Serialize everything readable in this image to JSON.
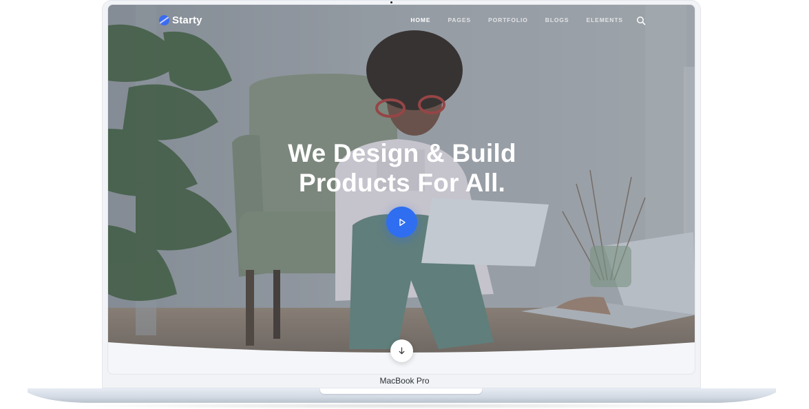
{
  "brand": {
    "name": "Starty",
    "accent": "#2f6ef0"
  },
  "nav": {
    "items": [
      {
        "label": "HOME",
        "active": true
      },
      {
        "label": "PAGES",
        "active": false
      },
      {
        "label": "PORTFOLIO",
        "active": false
      },
      {
        "label": "BLOGS",
        "active": false
      },
      {
        "label": "ELEMENTS",
        "active": false
      }
    ],
    "search_icon": "search-icon"
  },
  "hero": {
    "title_line1": "We Design & Build",
    "title_line2": "Products For All.",
    "play_icon": "play-icon",
    "scroll_icon": "arrow-down-icon"
  },
  "device": {
    "model": "MacBook Pro"
  }
}
